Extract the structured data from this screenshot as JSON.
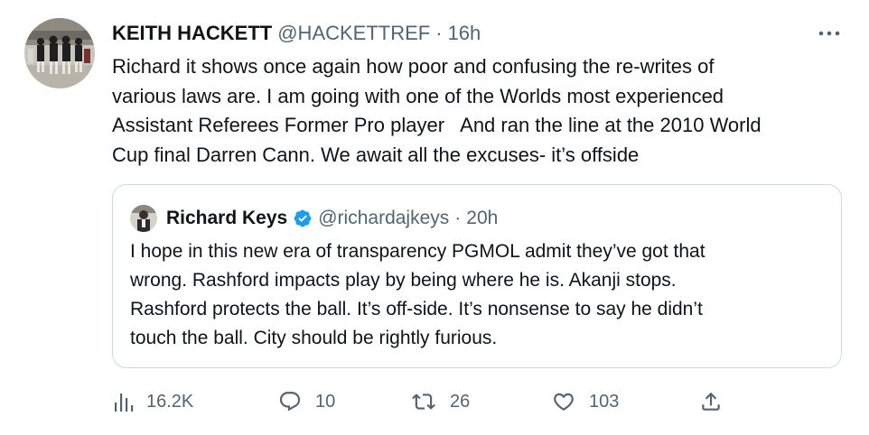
{
  "tweet": {
    "author_name": "KEITH HACKETT",
    "author_handle": "@HACKETTREF",
    "separator": "·",
    "time": "16h",
    "more_icon": "more-dots-icon",
    "text_lines": [
      "Richard it shows once again how poor and confusing the re-writes of",
      "various laws are. I am going with one of the Worlds most experienced",
      "Assistant Referees Former Pro player   And ran the line at the 2010 World",
      "Cup final Darren Cann. We await all the excuses- it’s offside"
    ]
  },
  "quote": {
    "author_name": "Richard Keys",
    "verified_icon": "verified-badge-icon",
    "author_handle": "@richardajkeys",
    "separator": "·",
    "time": "20h",
    "text_lines": [
      "I hope in this new era of transparency PGMOL admit they’ve got that",
      "wrong. Rashford impacts play by being where he is. Akanji stops.",
      "Rashford protects the ball. It’s off-side. It’s nonsense to say he didn’t",
      "touch the ball. City should be rightly furious."
    ]
  },
  "actions": {
    "views": {
      "icon": "views-chart-icon",
      "count": "16.2K"
    },
    "replies": {
      "icon": "reply-bubble-icon",
      "count": "10"
    },
    "retweets": {
      "icon": "retweet-icon",
      "count": "26"
    },
    "likes": {
      "icon": "heart-icon",
      "count": "103"
    },
    "share": {
      "icon": "share-upload-icon"
    }
  },
  "colors": {
    "text_primary": "#0f1419",
    "text_secondary": "#536471",
    "border": "#cfd9de",
    "verified_blue": "#1d9bf0"
  }
}
